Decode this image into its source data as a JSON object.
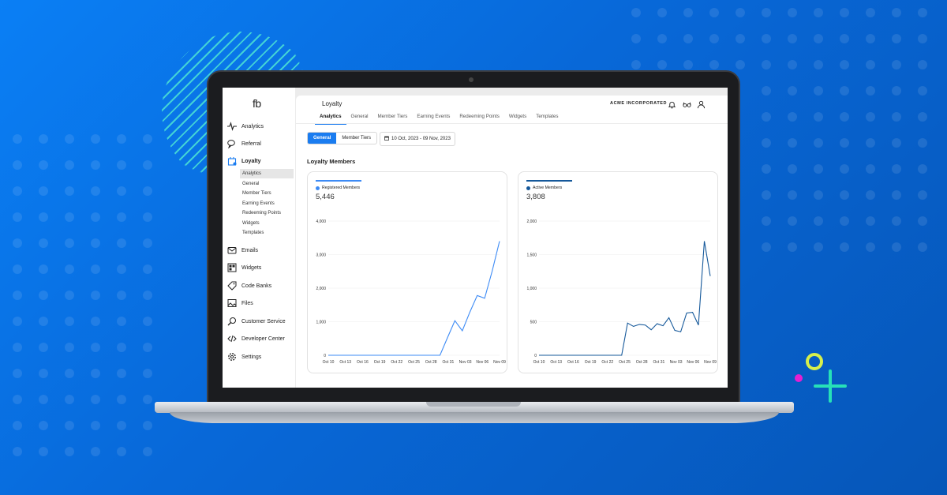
{
  "colors": {
    "accent": "#1a7cf0",
    "registered_line": "#3d8bf5",
    "active_line": "#15589a"
  },
  "sidebar": {
    "logo": "fb",
    "items": [
      {
        "label": "Analytics",
        "icon": "pulse-icon"
      },
      {
        "label": "Referral",
        "icon": "chat-bubbles-icon"
      },
      {
        "label": "Loyalty",
        "icon": "gift-icon",
        "active": true
      },
      {
        "label": "Emails",
        "icon": "envelope-icon"
      },
      {
        "label": "Widgets",
        "icon": "grid-icon"
      },
      {
        "label": "Code Banks",
        "icon": "tag-icon"
      },
      {
        "label": "Files",
        "icon": "image-icon"
      },
      {
        "label": "Customer Service",
        "icon": "headset-icon"
      },
      {
        "label": "Developer Center",
        "icon": "code-icon"
      },
      {
        "label": "Settings",
        "icon": "gear-icon"
      }
    ],
    "loyalty_sub": [
      "Analytics",
      "General",
      "Member Tiers",
      "Earning Events",
      "Redeeming Points",
      "Widgets",
      "Templates"
    ],
    "loyalty_sub_active": "Analytics"
  },
  "header": {
    "title": "Loyalty",
    "company": "ACME INCORPORATED",
    "tabs": [
      "Analytics",
      "General",
      "Member Tiers",
      "Earning Events",
      "Redeeming Points",
      "Widgets",
      "Templates"
    ],
    "active_tab": "Analytics"
  },
  "filters": {
    "segments": [
      "General",
      "Member Tiers"
    ],
    "active_segment": "General",
    "date_range": "10 Oct, 2023 - 09 Nov, 2023"
  },
  "section_title": "Loyalty Members",
  "chart_data": [
    {
      "type": "line",
      "series_name": "Registered Members",
      "total": "5,446",
      "x_ticks": [
        "Oct 10",
        "Oct 13",
        "Oct 16",
        "Oct 19",
        "Oct 22",
        "Oct 25",
        "Oct 28",
        "Oct 31",
        "Nov 03",
        "Nov 06",
        "Nov 09"
      ],
      "y_ticks": [
        "0",
        "1,000",
        "2,000",
        "3,000",
        "4,000"
      ],
      "ylim": [
        0,
        4000
      ],
      "values": [
        0,
        0,
        0,
        0,
        0,
        0,
        0,
        0,
        0,
        0,
        0,
        0,
        0,
        0,
        0,
        0,
        520,
        1030,
        730,
        1280,
        1780,
        1700,
        2500,
        3400
      ],
      "grid": true
    },
    {
      "type": "line",
      "series_name": "Active Members",
      "total": "3,808",
      "x_ticks": [
        "Oct 10",
        "Oct 13",
        "Oct 16",
        "Oct 19",
        "Oct 22",
        "Oct 25",
        "Oct 28",
        "Oct 31",
        "Nov 03",
        "Nov 06",
        "Nov 09"
      ],
      "y_ticks": [
        "0",
        "500",
        "1,000",
        "1,500",
        "2,000"
      ],
      "ylim": [
        0,
        2000
      ],
      "values": [
        0,
        0,
        0,
        0,
        0,
        0,
        0,
        0,
        0,
        0,
        0,
        0,
        0,
        0,
        0,
        480,
        430,
        460,
        450,
        380,
        470,
        440,
        560,
        370,
        350,
        630,
        640,
        450,
        1700,
        1180
      ],
      "grid": true
    }
  ]
}
